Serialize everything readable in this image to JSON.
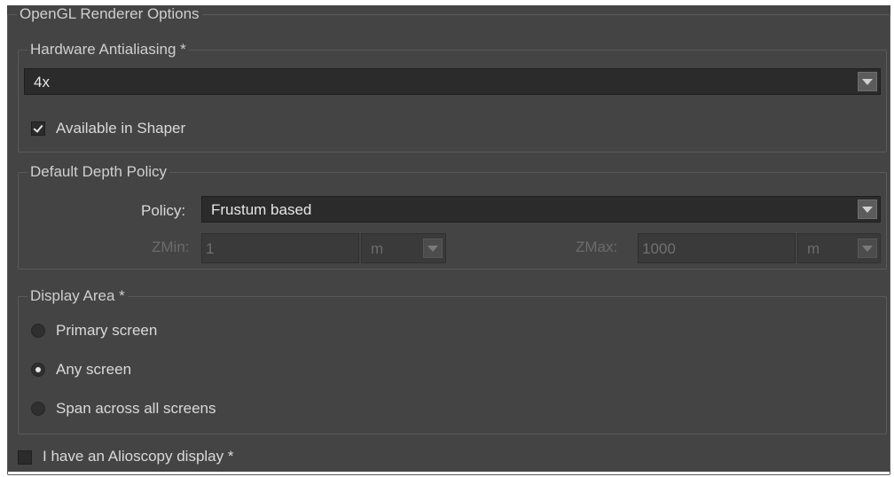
{
  "renderer": {
    "title": "OpenGL Renderer Options"
  },
  "hardware_aa": {
    "title": "Hardware Antialiasing *",
    "selected_value": "4x",
    "shaper_checkbox_label": "Available in Shaper",
    "shaper_checked": true
  },
  "depth_policy": {
    "title": "Default Depth Policy",
    "policy_label": "Policy:",
    "policy_value": "Frustum based",
    "zmin_label": "ZMin:",
    "zmin_value": "1",
    "zmin_unit": "m",
    "zmax_label": "ZMax:",
    "zmax_value": "1000",
    "zmax_unit": "m"
  },
  "display_area": {
    "title": "Display Area *",
    "options": [
      {
        "label": "Primary screen",
        "selected": false
      },
      {
        "label": "Any screen",
        "selected": true
      },
      {
        "label": "Span across all screens",
        "selected": false
      }
    ]
  },
  "alioscopy": {
    "label": "I have an Alioscopy display *",
    "checked": false
  },
  "icons": {
    "dropdown_arrow": "chevron-down-icon",
    "check": "check-icon"
  },
  "colors": {
    "panel_bg": "#444444",
    "field_bg": "#2b2b2b",
    "text": "#d9d9d9",
    "disabled_text": "#6b6b6b"
  }
}
